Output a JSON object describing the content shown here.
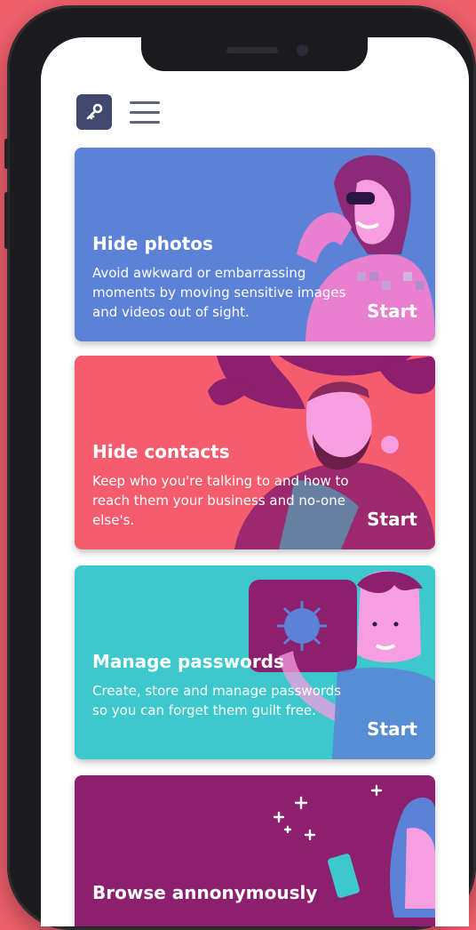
{
  "cards": [
    {
      "title": "Hide photos",
      "description": "Avoid awkward or embarrassing moments by moving sensitive images and videos out of sight.",
      "action": "Start",
      "color": "#5b82d6"
    },
    {
      "title": "Hide contacts",
      "description": "Keep who you're talking to and how to reach them your business and no-one else's.",
      "action": "Start",
      "color": "#f55d6e"
    },
    {
      "title": "Manage passwords",
      "description": "Create, store and manage passwords so you can forget them guilt free.",
      "action": "Start",
      "color": "#3cc8cc"
    },
    {
      "title": "Browse annonymously",
      "color": "#8c1f6e"
    }
  ],
  "colors": {
    "background": "#f2606d",
    "logo": "#3f4a6e",
    "menu": "#5f6478"
  },
  "icons": {
    "logo": "key-logo-icon",
    "menu": "hamburger-menu-icon"
  }
}
